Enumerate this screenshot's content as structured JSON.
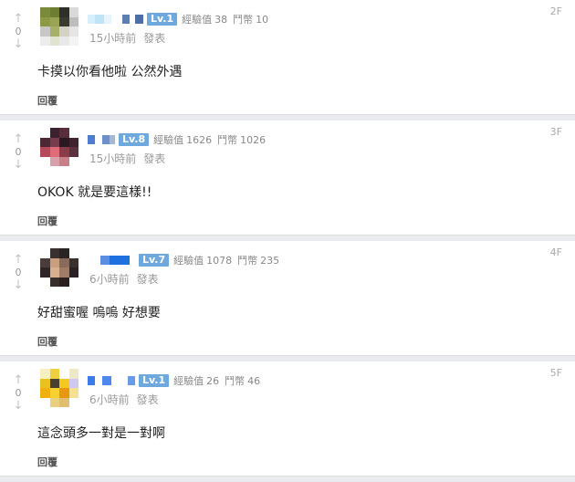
{
  "comments": [
    {
      "vote_up": "↑",
      "vote_count": "0",
      "vote_down": "↓",
      "level": "Lv.1",
      "exp_label": "經驗值",
      "exp_value": "38",
      "coin_label": "鬥幣",
      "coin_value": "10",
      "time": "15小時前",
      "post_label": "發表",
      "floor": "2F",
      "content": "卡摸以你看他啦 公然外遇",
      "reply_label": "回覆"
    },
    {
      "vote_up": "↑",
      "vote_count": "0",
      "vote_down": "↓",
      "level": "Lv.8",
      "exp_label": "經驗值",
      "exp_value": "1626",
      "coin_label": "鬥幣",
      "coin_value": "1026",
      "time": "15小時前",
      "post_label": "發表",
      "floor": "3F",
      "content": "OKOK 就是要這樣!!",
      "reply_label": "回覆"
    },
    {
      "vote_up": "↑",
      "vote_count": "0",
      "vote_down": "↓",
      "level": "Lv.7",
      "exp_label": "經驗值",
      "exp_value": "1078",
      "coin_label": "鬥幣",
      "coin_value": "235",
      "time": "6小時前",
      "post_label": "發表",
      "floor": "4F",
      "content": "好甜蜜喔 嗚嗚 好想要",
      "reply_label": "回覆"
    },
    {
      "vote_up": "↑",
      "vote_count": "0",
      "vote_down": "↓",
      "level": "Lv.1",
      "exp_label": "經驗值",
      "exp_value": "26",
      "coin_label": "鬥幣",
      "coin_value": "46",
      "time": "6小時前",
      "post_label": "發表",
      "floor": "5F",
      "content": "這念頭多一對是一對啊",
      "reply_label": "回覆"
    }
  ],
  "colors": {
    "level_badge": "#6fa8dc",
    "background": "#e9ebee",
    "card": "#ffffff"
  },
  "icons": {
    "vote_up": "arrow-up-icon",
    "vote_down": "arrow-down-icon"
  }
}
